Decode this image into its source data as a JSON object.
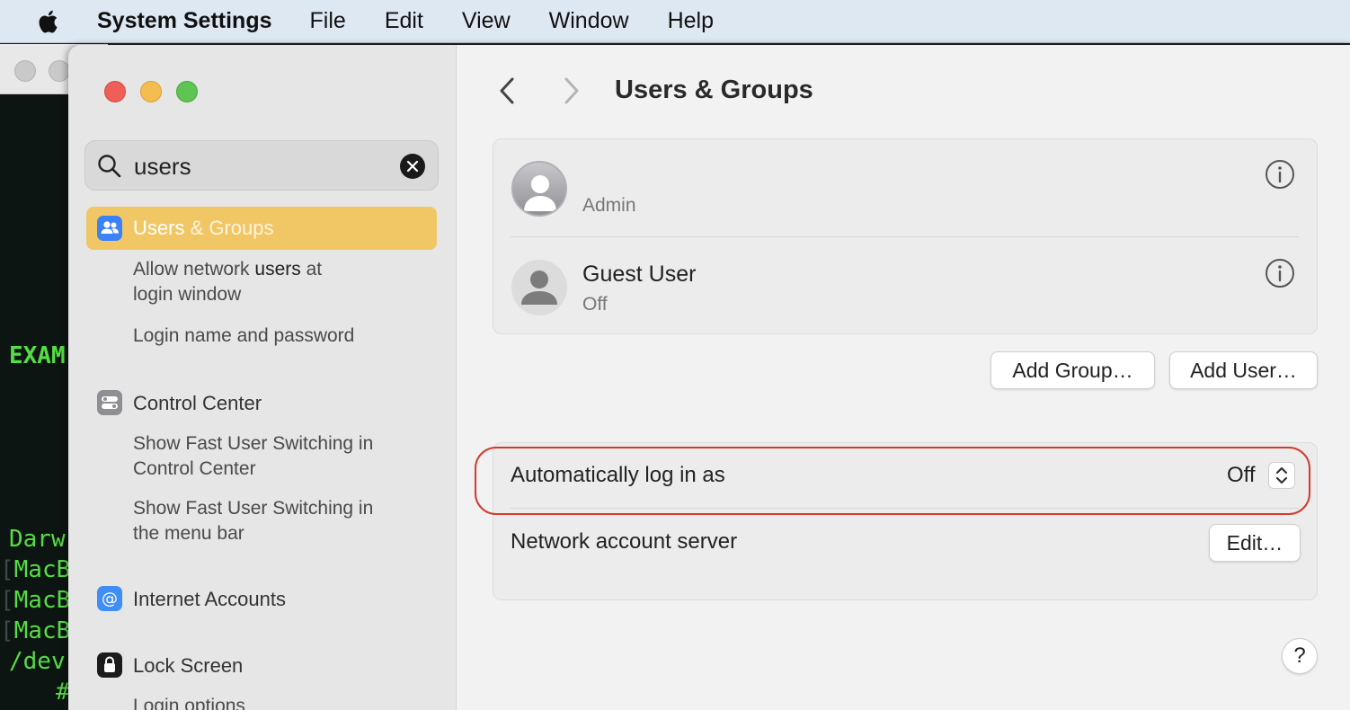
{
  "menubar": {
    "app_name": "System Settings",
    "items": [
      "File",
      "Edit",
      "View",
      "Window",
      "Help"
    ]
  },
  "terminal": {
    "lines": [
      "EXAM",
      "Darw",
      "MacB",
      "MacB",
      "MacB",
      "/dev",
      "#"
    ]
  },
  "sidebar": {
    "search": {
      "value": "users",
      "placeholder": "Search"
    },
    "selected": {
      "label_main": "Users",
      "label_rest": " & Groups"
    },
    "sub_allow": {
      "part1": "Allow network ",
      "part2": "users",
      "part3": " at",
      "line2": "login window"
    },
    "sub_login": "Login name and password",
    "control_center": {
      "label": "Control Center",
      "sub1_line1": "Show Fast User Switching in",
      "sub1_line2": "Control Center",
      "sub2_line1": "Show Fast User Switching in",
      "sub2_line2": "the menu bar"
    },
    "internet_accounts": {
      "label": "Internet Accounts"
    },
    "lock_screen": {
      "label": "Lock Screen",
      "sub": "Login options"
    }
  },
  "main": {
    "title": "Users & Groups",
    "users": [
      {
        "name": "",
        "role": "Admin"
      },
      {
        "name": "Guest User",
        "role": "Off"
      }
    ],
    "add_group_label": "Add Group…",
    "add_user_label": "Add User…",
    "auto_login": {
      "label": "Automatically log in as",
      "value": "Off"
    },
    "network_server": {
      "label": "Network account server",
      "button": "Edit…"
    },
    "help_label": "?"
  },
  "colors": {
    "selection": "#f1c766",
    "highlight_ring": "#d33a2c",
    "terminal_text": "#55dd44"
  }
}
